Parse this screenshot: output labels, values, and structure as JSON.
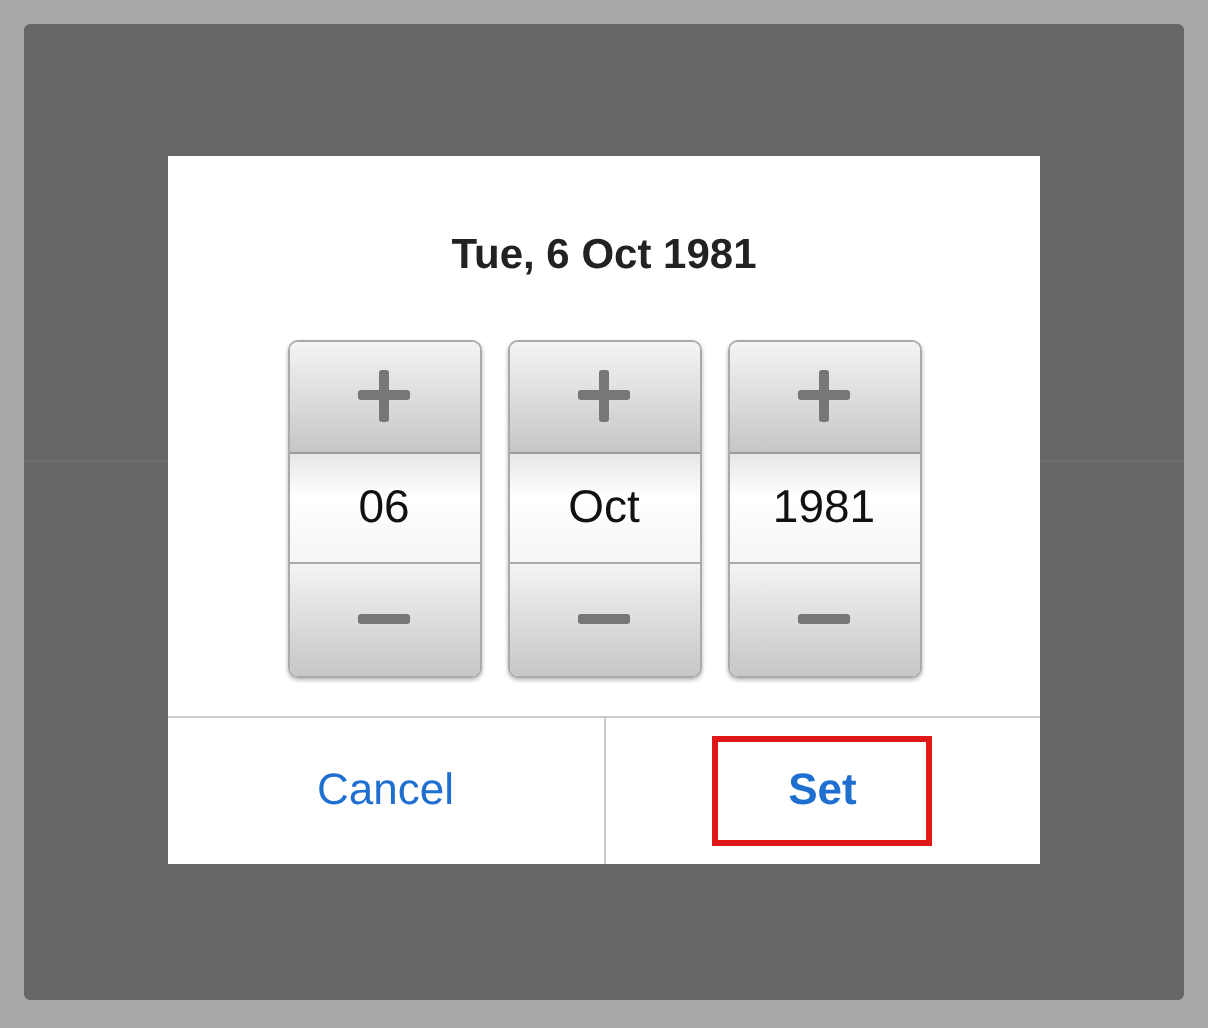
{
  "dialog": {
    "title": "Tue, 6 Oct 1981",
    "spinners": [
      {
        "value": "06"
      },
      {
        "value": "Oct"
      },
      {
        "value": "1981"
      }
    ],
    "buttons": [
      {
        "label": "Cancel",
        "highlighted": false
      },
      {
        "label": "Set",
        "highlighted": true
      }
    ]
  }
}
